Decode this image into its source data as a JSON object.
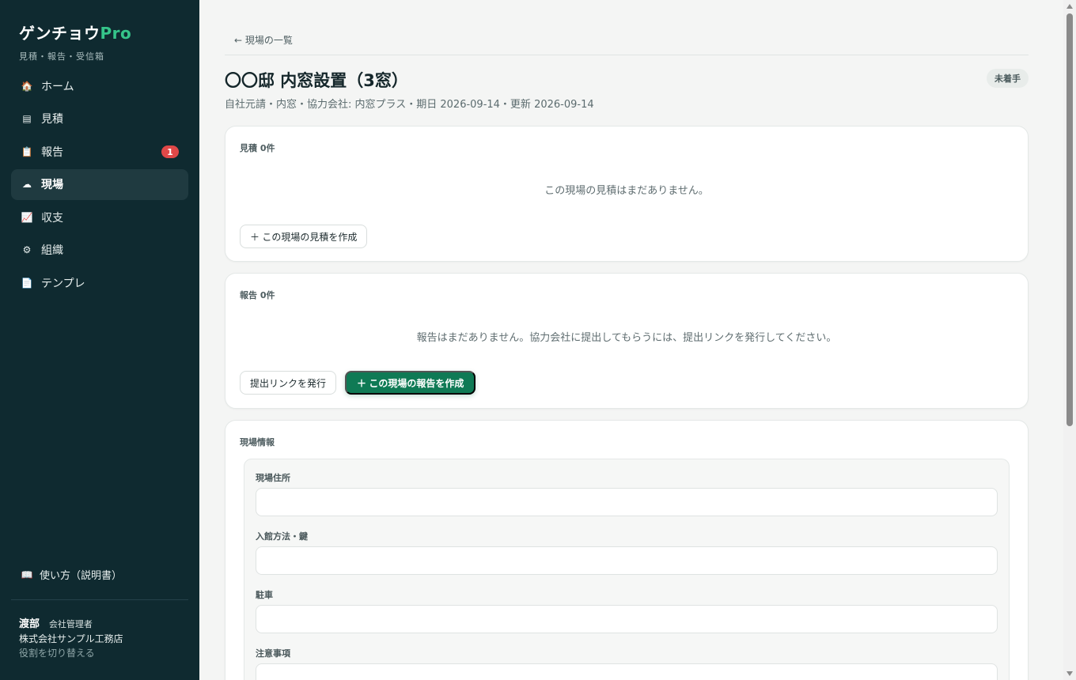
{
  "brand": {
    "name": "ゲンチョウ",
    "suffix": "Pro",
    "tagline": "見積・報告・受信箱"
  },
  "nav": [
    {
      "icon": "house-icon",
      "glyph": "🏠",
      "label": "ホーム"
    },
    {
      "icon": "estimate-icon",
      "glyph": "▤",
      "label": "見積"
    },
    {
      "icon": "report-icon",
      "glyph": "📋",
      "label": "報告",
      "badge": "1"
    },
    {
      "icon": "site-icon",
      "glyph": "☁",
      "label": "現場",
      "active": true
    },
    {
      "icon": "chart-icon",
      "glyph": "📈",
      "label": "収支"
    },
    {
      "icon": "gear-icon",
      "glyph": "⚙",
      "label": "組織"
    },
    {
      "icon": "document-icon",
      "glyph": "📄",
      "label": "テンプレ"
    }
  ],
  "help": {
    "glyph": "📖",
    "label": "使い方（説明書）"
  },
  "user": {
    "name": "渡部",
    "role": "会社管理者",
    "company": "株式会社サンプル工務店",
    "switch_label": "役割を切り替える"
  },
  "back": {
    "label": "← 現場の一覧"
  },
  "page": {
    "title": "〇〇邸 内窓設置（3窓）",
    "status": "未着手",
    "meta": "自社元請・内窓・協力会社: 内窓プラス・期日 2026-09-14・更新 2026-09-14"
  },
  "estimates": {
    "label": "見積 0件",
    "empty": "この現場の見積はまだありません。",
    "create_label": "＋ この現場の見積を作成"
  },
  "reports": {
    "label": "報告 0件",
    "empty": "報告はまだありません。協力会社に提出してもらうには、提出リンクを発行してください。",
    "issue_link_label": "提出リンクを発行",
    "create_label": "＋ この現場の報告を作成"
  },
  "site_info": {
    "label": "現場情報",
    "fields": [
      {
        "label": "現場住所",
        "value": ""
      },
      {
        "label": "入館方法・鍵",
        "value": ""
      },
      {
        "label": "駐車",
        "value": ""
      },
      {
        "label": "注意事項",
        "value": ""
      }
    ]
  },
  "colors": {
    "sidebar": "#0f2a30",
    "accent": "#0f7a55",
    "brand_accent": "#35c48a",
    "badge": "#e04848"
  }
}
